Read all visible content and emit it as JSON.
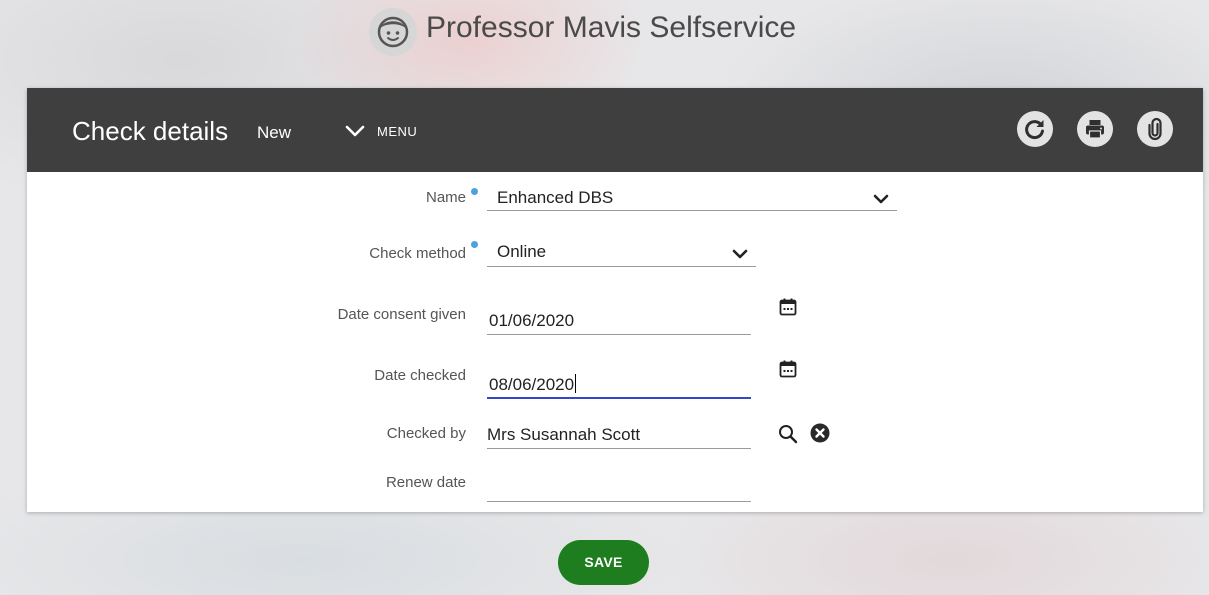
{
  "header": {
    "app_title": "Professor Mavis Selfservice",
    "avatar_icon": "smiley-face-icon"
  },
  "toolbar": {
    "title": "Check details",
    "status": "New",
    "menu_label": "MENU",
    "menu_icon": "chevron-down-icon",
    "actions": [
      {
        "name": "refresh",
        "icon": "refresh-icon"
      },
      {
        "name": "print",
        "icon": "printer-icon"
      },
      {
        "name": "attach",
        "icon": "paperclip-icon"
      }
    ]
  },
  "form": {
    "name": {
      "label": "Name",
      "required": true,
      "value": "Enhanced DBS"
    },
    "check_method": {
      "label": "Check method",
      "required": true,
      "value": "Online"
    },
    "date_consent_given": {
      "label": "Date consent given",
      "value": "01/06/2020",
      "icon": "calendar-icon"
    },
    "date_checked": {
      "label": "Date checked",
      "value": "08/06/2020",
      "icon": "calendar-icon",
      "focused": true
    },
    "checked_by": {
      "label": "Checked by",
      "value": "Mrs Susannah Scott",
      "search_icon": "search-icon",
      "clear_icon": "clear-icon"
    },
    "renew_date": {
      "label": "Renew date",
      "value": ""
    }
  },
  "actions": {
    "save_label": "SAVE"
  },
  "colors": {
    "toolbar_bg": "#3f3f3f",
    "required_dot": "#4aa3df",
    "focus_underline": "#3546c8",
    "save_button": "#1e7d1e"
  }
}
